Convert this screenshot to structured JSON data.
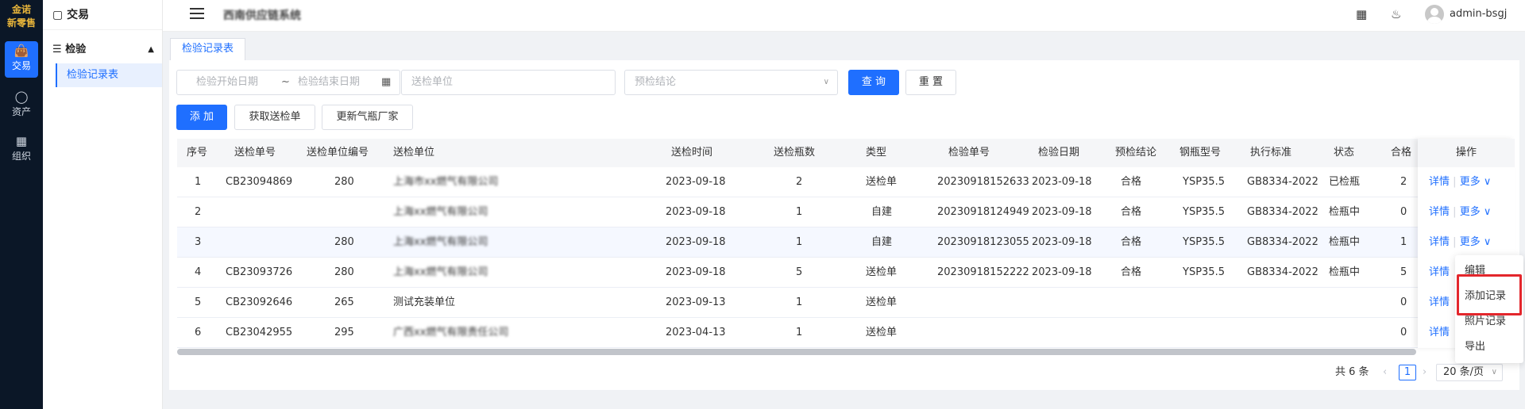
{
  "logo": {
    "line1": "金诺",
    "line2": "新零售"
  },
  "rail": [
    {
      "label": "交易",
      "icon": "bag-icon",
      "active": true
    },
    {
      "label": "资产",
      "icon": "bulb-icon",
      "active": false
    },
    {
      "label": "组织",
      "icon": "org-icon",
      "active": false
    }
  ],
  "sidebar": {
    "header": "交易",
    "group": "检验",
    "item": "检验记录表"
  },
  "topbar": {
    "title": "西南供应链系统",
    "user": "admin-bsgj"
  },
  "tab": "检验记录表",
  "filters": {
    "start_date": "检验开始日期",
    "range_sep": "~",
    "end_date": "检验结束日期",
    "unit": "送检单位",
    "conclusion": "预检结论",
    "query": "查 询",
    "reset": "重 置"
  },
  "actions": {
    "add": "添 加",
    "fetch": "获取送检单",
    "update": "更新气瓶厂家"
  },
  "columns": [
    "序号",
    "送检单号",
    "送检单位编号",
    "送检单位",
    "送检时间",
    "送检瓶数",
    "类型",
    "检验单号",
    "检验日期",
    "预检结论",
    "钢瓶型号",
    "执行标准",
    "状态",
    "合格",
    "操作"
  ],
  "rows": [
    {
      "no": "1",
      "order": "CB23094869",
      "unit_code": "280",
      "unit": "上海市xx燃气有限公司",
      "time": "2023-09-18",
      "count": "2",
      "type": "送检单",
      "insp_no": "20230918152633",
      "insp_date": "2023-09-18",
      "conclusion": "合格",
      "model": "YSP35.5",
      "standard": "GB8334-2022",
      "status": "已检瓶",
      "pass": "2"
    },
    {
      "no": "2",
      "order": "",
      "unit_code": "",
      "unit": "上海xx燃气有限公司",
      "time": "2023-09-18",
      "count": "1",
      "type": "自建",
      "insp_no": "20230918124949",
      "insp_date": "2023-09-18",
      "conclusion": "合格",
      "model": "YSP35.5",
      "standard": "GB8334-2022",
      "status": "检瓶中",
      "pass": "0"
    },
    {
      "no": "3",
      "order": "",
      "unit_code": "280",
      "unit": "上海xx燃气有限公司",
      "time": "2023-09-18",
      "count": "1",
      "type": "自建",
      "insp_no": "20230918123055",
      "insp_date": "2023-09-18",
      "conclusion": "合格",
      "model": "YSP35.5",
      "standard": "GB8334-2022",
      "status": "检瓶中",
      "pass": "1"
    },
    {
      "no": "4",
      "order": "CB23093726",
      "unit_code": "280",
      "unit": "上海xx燃气有限公司",
      "time": "2023-09-18",
      "count": "5",
      "type": "送检单",
      "insp_no": "20230918152222",
      "insp_date": "2023-09-18",
      "conclusion": "合格",
      "model": "YSP35.5",
      "standard": "GB8334-2022",
      "status": "检瓶中",
      "pass": "5"
    },
    {
      "no": "5",
      "order": "CB23092646",
      "unit_code": "265",
      "unit": "测试充装单位",
      "time": "2023-09-13",
      "count": "1",
      "type": "送检单",
      "insp_no": "",
      "insp_date": "",
      "conclusion": "",
      "model": "",
      "standard": "",
      "status": "",
      "pass": "0"
    },
    {
      "no": "6",
      "order": "CB23042955",
      "unit_code": "295",
      "unit": "广西xx燃气有限责任公司",
      "time": "2023-04-13",
      "count": "1",
      "type": "送检单",
      "insp_no": "",
      "insp_date": "",
      "conclusion": "",
      "model": "",
      "standard": "",
      "status": "",
      "pass": "0"
    }
  ],
  "row_actions": {
    "detail": "详情",
    "more": "更多"
  },
  "menu": [
    "编辑",
    "添加记录",
    "照片记录",
    "导出"
  ],
  "pager": {
    "total": "共 6 条",
    "page": "1",
    "size": "20 条/页"
  }
}
